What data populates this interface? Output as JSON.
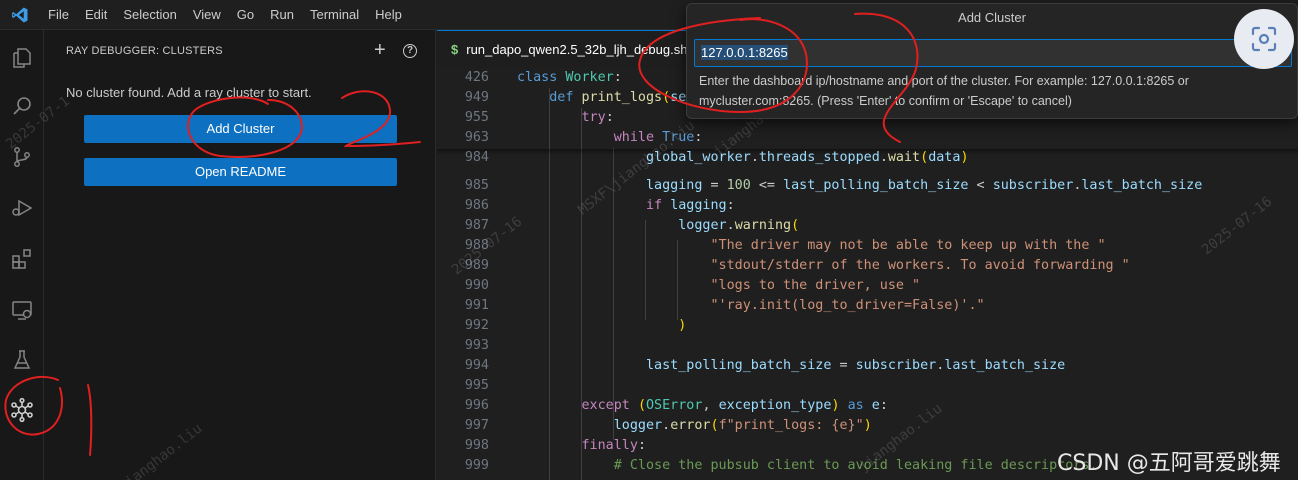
{
  "menu": {
    "items": [
      "File",
      "Edit",
      "Selection",
      "View",
      "Go",
      "Run",
      "Terminal",
      "Help"
    ]
  },
  "activity_bar": {
    "icons": [
      "explorer-icon",
      "search-icon",
      "source-control-icon",
      "run-debug-icon",
      "extensions-icon",
      "remote-explorer-icon",
      "testing-icon",
      "ray-debugger-icon"
    ]
  },
  "sidebar": {
    "title": "RAY DEBUGGER: CLUSTERS",
    "message": "No cluster found. Add a ray cluster to start.",
    "add_button": "Add Cluster",
    "readme_button": "Open README"
  },
  "editor": {
    "tab_label": "run_dapo_qwen2.5_32b_ljh_debug.sh",
    "lines": [
      {
        "n": "426",
        "code": "class Worker:"
      },
      {
        "n": "949",
        "code": "    def print_logs(self):"
      },
      {
        "n": "955",
        "code": "        try:"
      },
      {
        "n": "963",
        "code": "            while True:"
      },
      {
        "n": "984",
        "code": "                global_worker.threads_stopped.wait(data)"
      },
      {
        "n": "985",
        "code": "                lagging = 100 <= last_polling_batch_size < subscriber.last_batch_size"
      },
      {
        "n": "986",
        "code": "                if lagging:"
      },
      {
        "n": "987",
        "code": "                    logger.warning("
      },
      {
        "n": "988",
        "code": "                        \"The driver may not be able to keep up with the \""
      },
      {
        "n": "989",
        "code": "                        \"stdout/stderr of the workers. To avoid forwarding \""
      },
      {
        "n": "990",
        "code": "                        \"logs to the driver, use \""
      },
      {
        "n": "991",
        "code": "                        \"'ray.init(log_to_driver=False)'.\""
      },
      {
        "n": "992",
        "code": "                    )"
      },
      {
        "n": "993",
        "code": ""
      },
      {
        "n": "994",
        "code": "                last_polling_batch_size = subscriber.last_batch_size"
      },
      {
        "n": "995",
        "code": ""
      },
      {
        "n": "996",
        "code": "        except (OSError, exception_type) as e:"
      },
      {
        "n": "997",
        "code": "            logger.error(f\"print_logs: {e}\")"
      },
      {
        "n": "998",
        "code": "        finally:"
      },
      {
        "n": "999",
        "code": "            # Close the pubsub client to avoid leaking file descriptors."
      }
    ]
  },
  "quick_input": {
    "title": "Add Cluster",
    "value": "127.0.0.1:8265",
    "hint": "Enter the dashboard ip/hostname and port of the cluster. For example: 127.0.0.1:8265 or mycluster.com:8265. (Press 'Enter' to confirm or 'Escape' to cancel)"
  },
  "watermark": {
    "texts": [
      "2025-07-16",
      "MSXF\\jianghao.liu",
      "2025-07-16",
      "jianghao.liu",
      "jianghao.liu",
      "2025-07-1",
      "jianghao.liu"
    ],
    "csdn": "CSDN @五阿哥爱跳舞"
  },
  "annotations": {
    "color": "#e02020",
    "labels": [
      "1",
      "2"
    ]
  },
  "colors": {
    "accent": "#0078d4",
    "button": "#0e70c0"
  }
}
